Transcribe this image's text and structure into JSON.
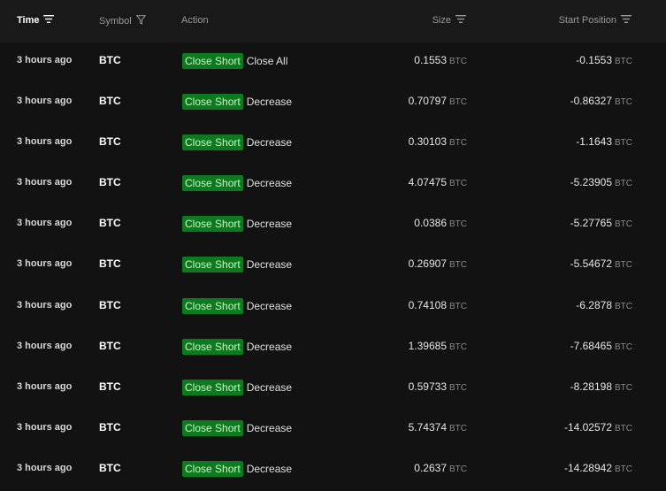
{
  "header": {
    "time": "Time",
    "symbol": "Symbol",
    "action": "Action",
    "size": "Size",
    "start_position": "Start Position"
  },
  "rows": [
    {
      "time": "3 hours ago",
      "symbol": "BTC",
      "badge": "Close Short",
      "action": "Close All",
      "size": "0.1553",
      "size_unit": "BTC",
      "start": "-0.1553",
      "start_unit": "BTC"
    },
    {
      "time": "3 hours ago",
      "symbol": "BTC",
      "badge": "Close Short",
      "action": "Decrease",
      "size": "0.70797",
      "size_unit": "BTC",
      "start": "-0.86327",
      "start_unit": "BTC"
    },
    {
      "time": "3 hours ago",
      "symbol": "BTC",
      "badge": "Close Short",
      "action": "Decrease",
      "size": "0.30103",
      "size_unit": "BTC",
      "start": "-1.1643",
      "start_unit": "BTC"
    },
    {
      "time": "3 hours ago",
      "symbol": "BTC",
      "badge": "Close Short",
      "action": "Decrease",
      "size": "4.07475",
      "size_unit": "BTC",
      "start": "-5.23905",
      "start_unit": "BTC"
    },
    {
      "time": "3 hours ago",
      "symbol": "BTC",
      "badge": "Close Short",
      "action": "Decrease",
      "size": "0.0386",
      "size_unit": "BTC",
      "start": "-5.27765",
      "start_unit": "BTC"
    },
    {
      "time": "3 hours ago",
      "symbol": "BTC",
      "badge": "Close Short",
      "action": "Decrease",
      "size": "0.26907",
      "size_unit": "BTC",
      "start": "-5.54672",
      "start_unit": "BTC"
    },
    {
      "time": "3 hours ago",
      "symbol": "BTC",
      "badge": "Close Short",
      "action": "Decrease",
      "size": "0.74108",
      "size_unit": "BTC",
      "start": "-6.2878",
      "start_unit": "BTC"
    },
    {
      "time": "3 hours ago",
      "symbol": "BTC",
      "badge": "Close Short",
      "action": "Decrease",
      "size": "1.39685",
      "size_unit": "BTC",
      "start": "-7.68465",
      "start_unit": "BTC"
    },
    {
      "time": "3 hours ago",
      "symbol": "BTC",
      "badge": "Close Short",
      "action": "Decrease",
      "size": "0.59733",
      "size_unit": "BTC",
      "start": "-8.28198",
      "start_unit": "BTC"
    },
    {
      "time": "3 hours ago",
      "symbol": "BTC",
      "badge": "Close Short",
      "action": "Decrease",
      "size": "5.74374",
      "size_unit": "BTC",
      "start": "-14.02572",
      "start_unit": "BTC"
    },
    {
      "time": "3 hours ago",
      "symbol": "BTC",
      "badge": "Close Short",
      "action": "Decrease",
      "size": "0.2637",
      "size_unit": "BTC",
      "start": "-14.28942",
      "start_unit": "BTC"
    }
  ],
  "colors": {
    "badge_bg": "#0d7a1f",
    "badge_text": "#c8f5c8",
    "background": "#121212",
    "header_bg": "#191919"
  },
  "icons": {
    "time_sort": "sort-lines-icon",
    "symbol_filter": "filter-funnel-icon",
    "size_sort": "sort-lines-icon",
    "start_sort": "sort-lines-icon"
  }
}
